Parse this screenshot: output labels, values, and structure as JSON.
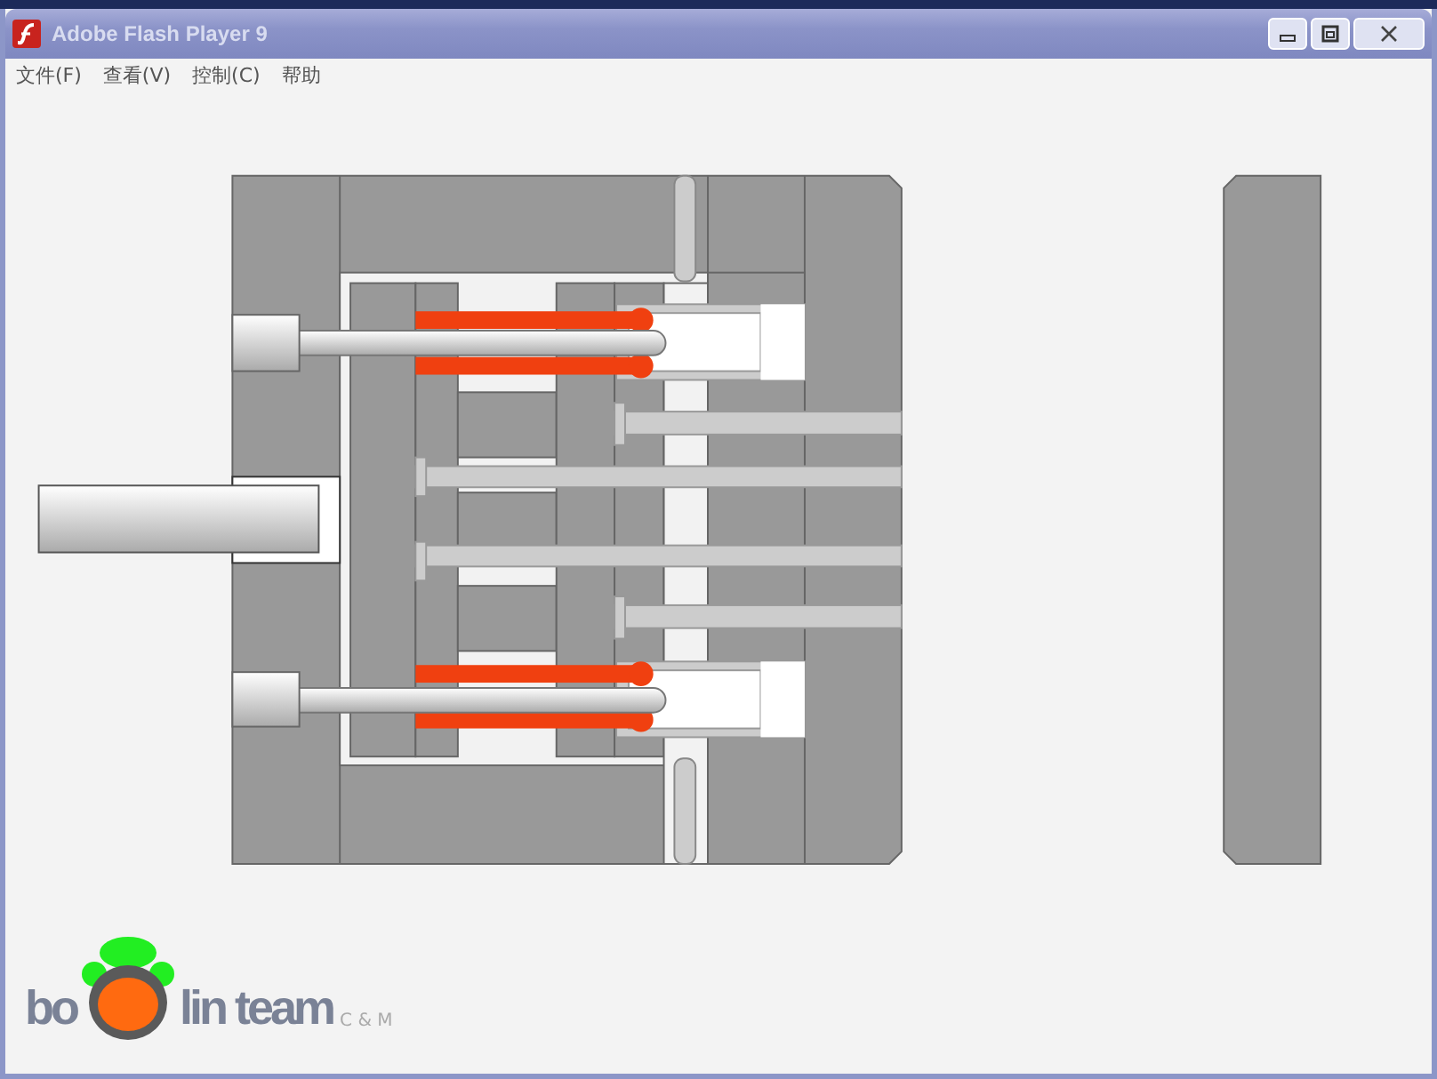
{
  "window": {
    "title": "Adobe Flash Player 9"
  },
  "menu": [
    {
      "label": "文件(F)"
    },
    {
      "label": "查看(V)"
    },
    {
      "label": "控制(C)"
    },
    {
      "label": "帮助"
    }
  ],
  "logo": {
    "left": "bo",
    "right": "lin team",
    "tag": "C & M"
  }
}
